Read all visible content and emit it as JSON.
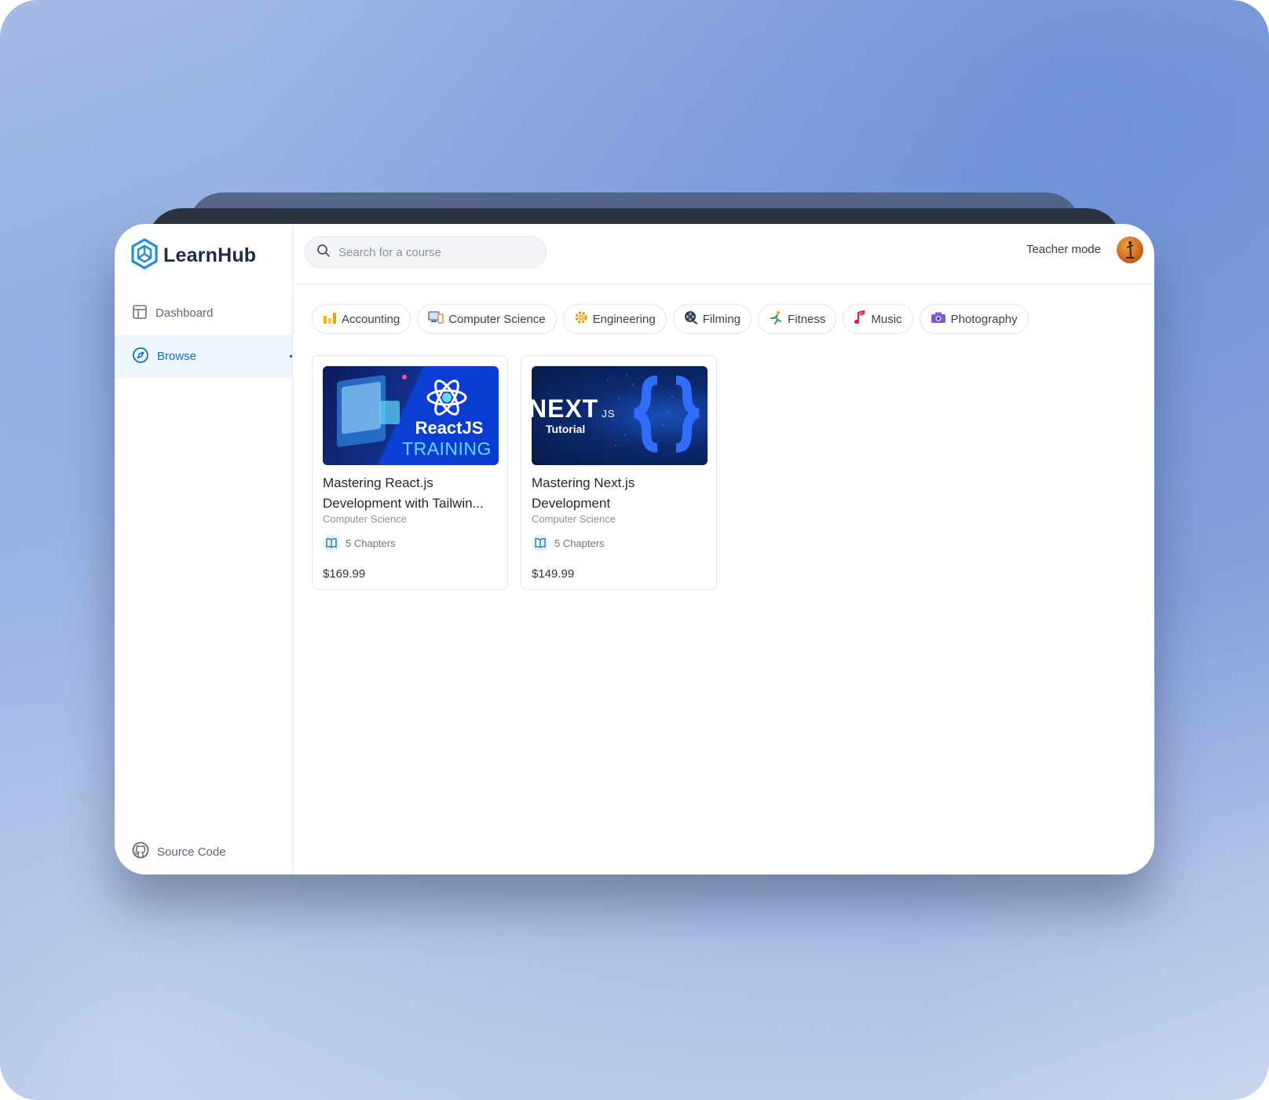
{
  "app": {
    "name": "LearnHub"
  },
  "sidebar": {
    "items": [
      {
        "label": "Dashboard",
        "icon": "layout-icon",
        "active": false
      },
      {
        "label": "Browse",
        "icon": "compass-icon",
        "active": true
      }
    ],
    "footer": {
      "label": "Source Code",
      "icon": "github-icon"
    }
  },
  "topbar": {
    "search_placeholder": "Search for a course",
    "teacher_mode_label": "Teacher mode"
  },
  "categories": [
    {
      "label": "Accounting",
      "icon": "bar-chart-icon"
    },
    {
      "label": "Computer Science",
      "icon": "computer-icon"
    },
    {
      "label": "Engineering",
      "icon": "gear-icon"
    },
    {
      "label": "Filming",
      "icon": "film-reel-icon"
    },
    {
      "label": "Fitness",
      "icon": "runner-icon"
    },
    {
      "label": "Music",
      "icon": "music-note-icon"
    },
    {
      "label": "Photography",
      "icon": "camera-icon"
    }
  ],
  "courses": [
    {
      "title": "Mastering React.js Development with Tailwin...",
      "category": "Computer Science",
      "chapters": "5 Chapters",
      "price": "$169.99",
      "thumb_line1": "ReactJS",
      "thumb_line2": "TRAINING"
    },
    {
      "title": "Mastering Next.js Development",
      "category": "Computer Science",
      "chapters": "5 Chapters",
      "price": "$149.99",
      "thumb_line1": "NEXT",
      "thumb_sub": "JS",
      "thumb_line2": "Tutorial"
    }
  ],
  "colors": {
    "accent": "#0b72b4",
    "active_bg": "#eef6fd"
  }
}
